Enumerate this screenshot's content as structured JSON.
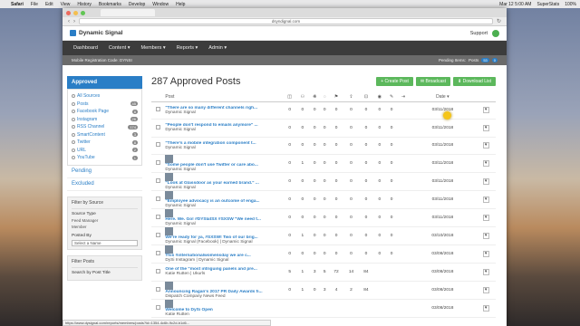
{
  "mac_menu": {
    "app": "Safari",
    "items": [
      "File",
      "Edit",
      "View",
      "History",
      "Bookmarks",
      "Develop",
      "Window",
      "Help"
    ],
    "right": [
      "Mar 12 5:00 AM",
      "SuperStats",
      "100%"
    ]
  },
  "browser": {
    "url": "dsyndignal.com"
  },
  "app": {
    "brand": "Dynamic Signal",
    "support": "Support",
    "nav": [
      "Dashboard",
      "Content ▾",
      "Members ▾",
      "Reports ▾",
      "Admin ▾"
    ],
    "subbar_left": "Mobile Registration Code: DYNSI",
    "pending_label": "Pending Items:",
    "pending_a": "Posts",
    "pending_a_count": "53",
    "pending_b_count": "0"
  },
  "sidebar": {
    "approved": "Approved",
    "sources": [
      {
        "label": "All Sources",
        "count": ""
      },
      {
        "label": "Posts",
        "count": "45"
      },
      {
        "label": "Facebook Page",
        "count": "8"
      },
      {
        "label": "Instagram",
        "count": "26"
      },
      {
        "label": "RSS Channel",
        "count": "174"
      },
      {
        "label": "SmartContent",
        "count": "3"
      },
      {
        "label": "Twitter",
        "count": "8"
      },
      {
        "label": "URL",
        "count": "2"
      },
      {
        "label": "YouTube",
        "count": "1"
      }
    ],
    "pending": "Pending",
    "excluded": "Excluded",
    "filter_title": "Filter by Source",
    "source_type": "Source Type",
    "source_type_opts": [
      "Feed Manager",
      "Member"
    ],
    "posted_by": "Posted By",
    "posted_by_placeholder": "Select a Name",
    "filter_posts": "Filter Posts",
    "search_label": "Search by Post Title"
  },
  "main": {
    "title": "287 Approved Posts",
    "create": "+ Create Post",
    "broadcast": "✉ Broadcast",
    "download": "⬇ Download List",
    "col_post": "Post",
    "col_date": "Date ▾",
    "rows": [
      {
        "title": "\"There are so many different channels righ...",
        "author": "Dynamic Signal",
        "thumb": false,
        "v": [
          "0",
          "0",
          "0",
          "0",
          "0",
          "0",
          "0",
          "0",
          "0"
        ],
        "date": "03/11/2018"
      },
      {
        "title": "\"People don't respond to emails anymore\" ...",
        "author": "Dynamic Signal",
        "thumb": false,
        "v": [
          "0",
          "0",
          "0",
          "0",
          "0",
          "0",
          "0",
          "0",
          "0"
        ],
        "date": "03/11/2018"
      },
      {
        "title": "\"There's a mobile integration component t...",
        "author": "Dynamic Signal",
        "thumb": false,
        "v": [
          "0",
          "0",
          "0",
          "0",
          "0",
          "0",
          "0",
          "0",
          "0"
        ],
        "date": "03/11/2018"
      },
      {
        "title": "\"Some people don't use Twitter or care abo...",
        "author": "Dynamic Signal",
        "thumb": true,
        "v": [
          "0",
          "1",
          "0",
          "0",
          "0",
          "0",
          "0",
          "0",
          "0"
        ],
        "date": "03/11/2018"
      },
      {
        "title": "\"Look at Glassdoor as your earned brand.\" ...",
        "author": "Dynamic Signal",
        "thumb": true,
        "v": [
          "0",
          "0",
          "0",
          "0",
          "0",
          "0",
          "0",
          "0",
          "0"
        ],
        "date": "03/11/2018"
      },
      {
        "title": "\"Employee advocacy is an outcome of enga...",
        "author": "Dynamic Signal",
        "thumb": true,
        "v": [
          "0",
          "0",
          "0",
          "0",
          "0",
          "0",
          "0",
          "0",
          "0"
        ],
        "date": "03/11/2018"
      },
      {
        "title": "Here. We. Go! #DYSIatSX #SXSW \"We need t...",
        "author": "Dynamic Signal",
        "thumb": true,
        "v": [
          "0",
          "0",
          "0",
          "0",
          "0",
          "0",
          "0",
          "0",
          "0"
        ],
        "date": "03/11/2018"
      },
      {
        "title": "We're ready for ya, #SXSW! Two of our brig...",
        "author": "Dynamic Signal (Facebook) | Dynamic Signal",
        "thumb": true,
        "v": [
          "0",
          "1",
          "0",
          "0",
          "0",
          "0",
          "0",
          "0",
          "0"
        ],
        "date": "03/10/2018"
      },
      {
        "title": "This #internationalwomensday we are c...",
        "author": "DySi Instagram | Dynamic Signal",
        "thumb": true,
        "v": [
          "0",
          "0",
          "0",
          "0",
          "0",
          "0",
          "0",
          "0",
          "0"
        ],
        "date": "03/08/2018"
      },
      {
        "title": "One of the \"most intriguing panels and pre...",
        "author": "Katie Rutten | Ukurls",
        "thumb": false,
        "v": [
          "5",
          "1",
          "3",
          "5",
          "72",
          "14",
          "84",
          "",
          ""
        ],
        "date": "03/08/2018"
      },
      {
        "title": "Announcing Ragan's 2017 PR Daily Awards fi...",
        "author": "Dispatch Company News Feed",
        "thumb": true,
        "v": [
          "0",
          "1",
          "0",
          "3",
          "4",
          "2",
          "84",
          "",
          ""
        ],
        "date": "03/08/2018"
      },
      {
        "title": "Welcome to DySi Open",
        "author": "Katie Rutten",
        "thumb": true,
        "v": [
          "",
          "",
          "",
          "",
          "",
          "",
          "",
          "",
          ""
        ],
        "date": "03/08/2018"
      }
    ]
  },
  "status_bar": "https://www.dysignal.com/reports/members/posts?id=1354-4c6b-9c2d-b1d6..."
}
